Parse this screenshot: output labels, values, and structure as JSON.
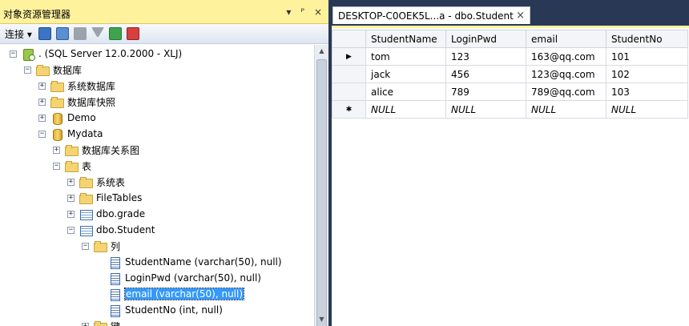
{
  "object_explorer": {
    "title": "对象资源管理器",
    "title_buttons": [
      "▾",
      "ᴾ",
      "×"
    ],
    "toolbar": {
      "connect_label": "连接 ▾"
    },
    "tree": [
      {
        "label": ". (SQL Server 12.0.2000 - XLJ)",
        "icon": "server-icon",
        "expander": "−",
        "level": 0
      },
      {
        "label": "数据库",
        "icon": "folder-icon",
        "expander": "−",
        "level": 1
      },
      {
        "label": "系统数据库",
        "icon": "folder-icon",
        "expander": "+",
        "level": 2
      },
      {
        "label": "数据库快照",
        "icon": "folder-icon",
        "expander": "+",
        "level": 2
      },
      {
        "label": "Demo",
        "icon": "database-icon",
        "expander": "+",
        "level": 2
      },
      {
        "label": "Mydata",
        "icon": "database-icon",
        "expander": "−",
        "level": 2
      },
      {
        "label": "数据库关系图",
        "icon": "folder-icon",
        "expander": "+",
        "level": 3
      },
      {
        "label": "表",
        "icon": "folder-icon",
        "expander": "−",
        "level": 3
      },
      {
        "label": "系统表",
        "icon": "folder-icon",
        "expander": "+",
        "level": 4
      },
      {
        "label": "FileTables",
        "icon": "folder-icon",
        "expander": "+",
        "level": 4
      },
      {
        "label": "dbo.grade",
        "icon": "table-icon",
        "expander": "+",
        "level": 4
      },
      {
        "label": "dbo.Student",
        "icon": "table-icon",
        "expander": "−",
        "level": 4
      },
      {
        "label": "列",
        "icon": "folder-icon",
        "expander": "−",
        "level": 5
      },
      {
        "label": "StudentName (varchar(50), null)",
        "icon": "column-icon",
        "expander": "",
        "level": 6
      },
      {
        "label": "LoginPwd (varchar(50), null)",
        "icon": "column-icon",
        "expander": "",
        "level": 6
      },
      {
        "label": "email (varchar(50), null)",
        "icon": "column-icon",
        "expander": "",
        "level": 6,
        "selected": true
      },
      {
        "label": "StudentNo (int, null)",
        "icon": "column-icon",
        "expander": "",
        "level": 6
      },
      {
        "label": "键",
        "icon": "folder-icon",
        "expander": "+",
        "level": 5
      }
    ]
  },
  "document": {
    "tab_title": "DESKTOP-C0OEK5L...a - dbo.Student",
    "tab_close": "×",
    "grid": {
      "columns": [
        "StudentName",
        "LoginPwd",
        "email",
        "StudentNo"
      ],
      "rows": [
        {
          "marker": "▶",
          "cells": [
            "tom",
            "123",
            "163@qq.com",
            "101"
          ]
        },
        {
          "marker": "",
          "cells": [
            "jack",
            "456",
            "123@qq.com",
            "102"
          ]
        },
        {
          "marker": "",
          "cells": [
            "alice",
            "789",
            "789@qq.com",
            "103"
          ]
        },
        {
          "marker": "✱",
          "cells": [
            "NULL",
            "NULL",
            "NULL",
            "NULL"
          ],
          "is_new": true
        }
      ]
    }
  }
}
